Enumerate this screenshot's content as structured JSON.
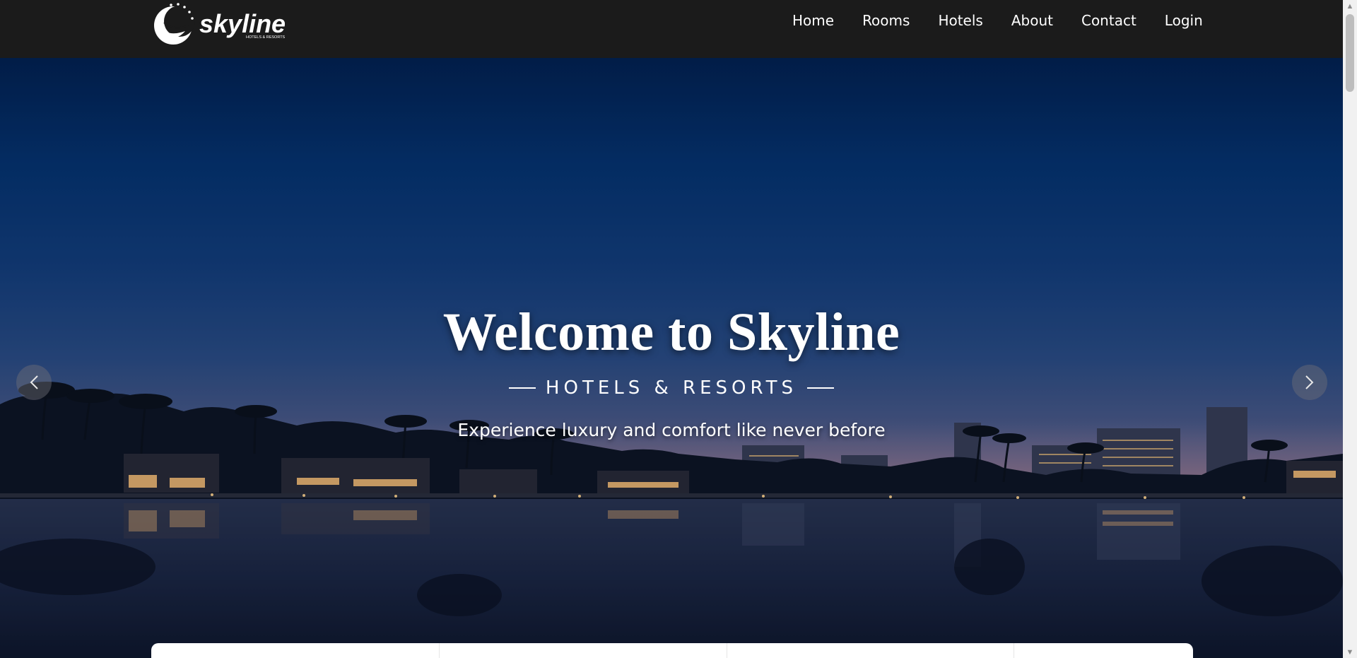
{
  "brand": {
    "name": "skyline",
    "tagline": "HOTELS & RESORTS"
  },
  "nav": {
    "items": [
      {
        "label": "Home"
      },
      {
        "label": "Rooms"
      },
      {
        "label": "Hotels"
      },
      {
        "label": "About"
      },
      {
        "label": "Contact"
      },
      {
        "label": "Login"
      }
    ]
  },
  "hero": {
    "title": "Welcome to Skyline",
    "subtitle": "HOTELS & RESORTS",
    "tagline": "Experience luxury and comfort like never before"
  },
  "icons": {
    "prev": "chevron-left-icon",
    "next": "chevron-right-icon"
  },
  "colors": {
    "navbar": "#1b1b1b",
    "sky_top": "#02214f",
    "text": "#ffffff"
  }
}
